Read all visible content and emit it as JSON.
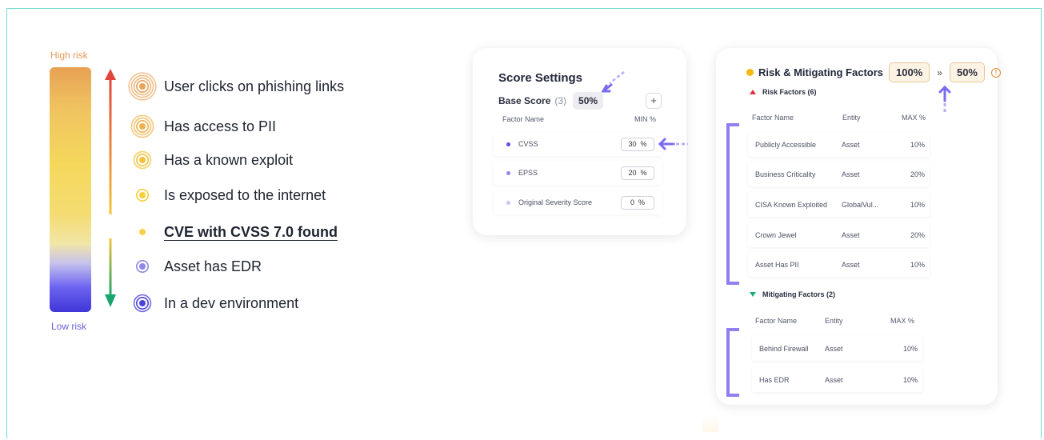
{
  "risk_scale": {
    "high_label": "High risk",
    "low_label": "Low risk",
    "gradient_colors": [
      "#e8a155",
      "#f5d85c",
      "#f2e6a6",
      "#6c63f0",
      "#3f36d8"
    ],
    "arrow_up_color": "#e0463b",
    "arrow_down_color": "#1aa46e",
    "factors": [
      {
        "label": "User clicks on phishing links",
        "icon": "concentric-ring-icon",
        "color": "#e9a35a",
        "bold": false
      },
      {
        "label": "Has access to PII",
        "icon": "concentric-ring-icon",
        "color": "#f0b24a",
        "bold": false
      },
      {
        "label": "Has a known exploit",
        "icon": "concentric-ring-icon",
        "color": "#f4c23a",
        "bold": false
      },
      {
        "label": "Is exposed to the internet",
        "icon": "concentric-ring-icon",
        "color": "#f5cf3a",
        "bold": false
      },
      {
        "label": "CVE with CVSS 7.0 found",
        "icon": "dot-icon",
        "color": "#f5d24a",
        "bold": true
      },
      {
        "label": "Asset has EDR",
        "icon": "concentric-ring-icon",
        "color": "#8e88e6",
        "bold": false
      },
      {
        "label": "In a dev environment",
        "icon": "concentric-ring-icon",
        "color": "#4c43d8",
        "bold": false
      }
    ]
  },
  "score_settings": {
    "title": "Score Settings",
    "base_score_label": "Base Score",
    "base_score_count": "(3)",
    "base_score_pct": "50%",
    "add_label": "+",
    "col_factor": "Factor Name",
    "col_min": "MIN %",
    "rows": [
      {
        "name": "CVSS",
        "value": "30",
        "unit": "%",
        "dot_color": "#5b4ee6"
      },
      {
        "name": "EPSS",
        "value": "20",
        "unit": "%",
        "dot_color": "#8f86ea"
      },
      {
        "name": "Original Severity Score",
        "value": "0",
        "unit": "%",
        "dot_color": "#c9c5f2"
      }
    ]
  },
  "risk_mitigating": {
    "title": "Risk & Mitigating Factors",
    "total_pct": "100%",
    "separator": "»",
    "cap_pct": "50%",
    "info_glyph": "!",
    "risk_factors": {
      "heading": "Risk Factors (6)",
      "col_factor": "Factor Name",
      "col_entity": "Entity",
      "col_max": "MAX %",
      "rows": [
        {
          "name": "Publicly Accessible",
          "entity": "Asset",
          "max": "10%"
        },
        {
          "name": "Business Criticality",
          "entity": "Asset",
          "max": "20%"
        },
        {
          "name": "CISA Known Exploited",
          "entity": "GlobalVul...",
          "max": "10%"
        },
        {
          "name": "Crown Jewel",
          "entity": "Asset",
          "max": "20%"
        },
        {
          "name": "Asset Has PII",
          "entity": "Asset",
          "max": "10%"
        }
      ]
    },
    "mitigating_factors": {
      "heading": "Mitigating Factors (2)",
      "col_factor": "Factor Name",
      "col_entity": "Entity",
      "col_max": "MAX %",
      "rows": [
        {
          "name": "Behind Firewall",
          "entity": "Asset",
          "max": "10%"
        },
        {
          "name": "Has EDR",
          "entity": "Asset",
          "max": "10%"
        }
      ]
    }
  },
  "accent_color": "#7a6cf0"
}
